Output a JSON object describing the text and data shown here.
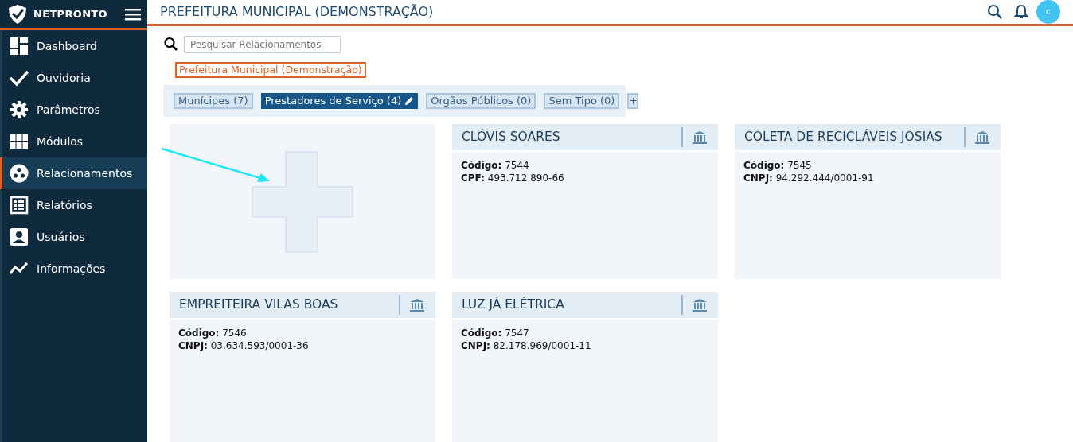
{
  "brand": {
    "name": "NETPRONTO"
  },
  "header": {
    "title": "PREFEITURA MUNICIPAL (DEMONSTRAÇÃO)",
    "avatar": "c"
  },
  "sidebar": {
    "items": [
      {
        "label": "Dashboard",
        "selected": false
      },
      {
        "label": "Ouvidoria",
        "selected": false
      },
      {
        "label": "Parâmetros",
        "selected": false
      },
      {
        "label": "Módulos",
        "selected": false
      },
      {
        "label": "Relacionamentos",
        "selected": true
      },
      {
        "label": "Relatórios",
        "selected": false
      },
      {
        "label": "Usuários",
        "selected": false
      },
      {
        "label": "Informações",
        "selected": false
      }
    ]
  },
  "search": {
    "placeholder": "Pesquisar Relacionamentos"
  },
  "organization": "Prefeitura Municipal (Demonstração)",
  "tabs": [
    {
      "label": "Munícipes (7)",
      "selected": false
    },
    {
      "label": "Prestadores de Serviço (4)",
      "selected": true
    },
    {
      "label": "Órgãos Públicos (0)",
      "selected": false
    },
    {
      "label": "Sem Tipo (0)",
      "selected": false
    }
  ],
  "add_tab": "+",
  "cards": [
    {
      "kind": "add"
    },
    {
      "kind": "entity",
      "title": "CLÓVIS SOARES",
      "lines": [
        "**Código:** 7544",
        "**CPF:** 493.712.890-66"
      ]
    },
    {
      "kind": "entity",
      "title": "COLETA DE RECICLÁVEIS JOSIAS",
      "lines": [
        "**Código:** 7545",
        "**CNPJ:** 94.292.444/0001-91"
      ]
    },
    {
      "kind": "entity",
      "title": "EMPREITEIRA VILAS BOAS",
      "lines": [
        "**Código:** 7546",
        "**CNPJ:** 03.634.593/0001-36"
      ]
    },
    {
      "kind": "entity",
      "title": "LUZ JÁ ELÉTRICA",
      "lines": [
        "**Código:** 7547",
        "**CNPJ:** 82.178.969/0001-11"
      ]
    }
  ]
}
